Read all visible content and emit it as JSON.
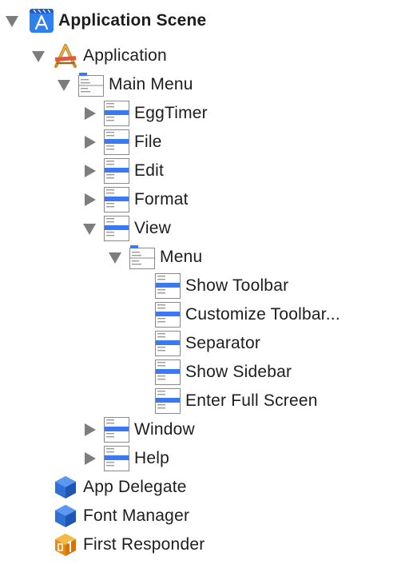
{
  "tree": {
    "scene": {
      "label": "Application Scene",
      "icon": "storyboard-scene-icon"
    },
    "application": {
      "label": "Application",
      "icon": "application-icon"
    },
    "main_menu": {
      "label": "Main Menu",
      "icon": "menu-icon"
    },
    "menu_items": [
      {
        "label": "EggTimer"
      },
      {
        "label": "File"
      },
      {
        "label": "Edit"
      },
      {
        "label": "Format"
      },
      {
        "label": "View"
      }
    ],
    "view_menu": {
      "label": "Menu",
      "icon": "menu-icon"
    },
    "view_items": [
      {
        "label": "Show Toolbar"
      },
      {
        "label": "Customize Toolbar..."
      },
      {
        "label": "Separator"
      },
      {
        "label": "Show Sidebar"
      },
      {
        "label": "Enter Full Screen"
      }
    ],
    "after_items": [
      {
        "label": "Window"
      },
      {
        "label": "Help"
      }
    ],
    "objects": [
      {
        "label": "App Delegate",
        "icon": "blue-cube-icon"
      },
      {
        "label": "Font Manager",
        "icon": "blue-cube-icon"
      },
      {
        "label": "First Responder",
        "icon": "first-responder-icon"
      }
    ]
  },
  "colors": {
    "accent": "#3b78f5",
    "disclosure": "#7d7d7d",
    "responder": "#f5a623"
  }
}
